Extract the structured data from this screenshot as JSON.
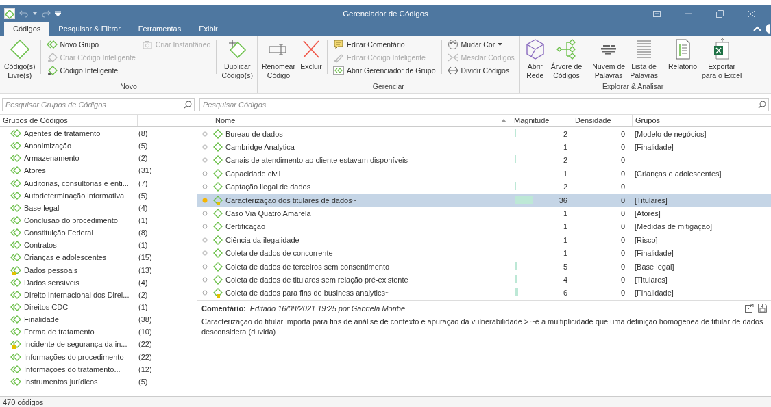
{
  "window": {
    "title": "Gerenciador de Códigos"
  },
  "tabs": [
    {
      "label": "Códigos",
      "selected": true
    },
    {
      "label": "Pesquisar & Filtrar",
      "selected": false
    },
    {
      "label": "Ferramentas",
      "selected": false
    },
    {
      "label": "Exibir",
      "selected": false
    }
  ],
  "ribbon": {
    "groups": [
      {
        "label": "Novo",
        "columns": [
          {
            "kind": "large",
            "label": "Código(s)\nLivre(s)",
            "disabled": false
          },
          {
            "kind": "separator"
          },
          {
            "kind": "stack",
            "items": [
              {
                "label": "Novo Grupo",
                "disabled": false,
                "has_menu": false
              },
              {
                "label": "Criar Código Inteligente",
                "disabled": true,
                "has_menu": false
              },
              {
                "label": "Código Inteligente",
                "disabled": false,
                "has_menu": false
              }
            ]
          },
          {
            "kind": "stack",
            "items": [
              {
                "label": "Criar Instantâneo",
                "disabled": true,
                "has_menu": false
              }
            ]
          },
          {
            "kind": "separator"
          },
          {
            "kind": "large",
            "label": "Duplicar\nCódigo(s)",
            "disabled": false
          }
        ]
      },
      {
        "label": "Gerenciar",
        "columns": [
          {
            "kind": "large",
            "label": "Renomear\nCódigo",
            "disabled": false
          },
          {
            "kind": "large",
            "label": "Excluir",
            "disabled": false
          },
          {
            "kind": "separator"
          },
          {
            "kind": "stack",
            "items": [
              {
                "label": "Editar Comentário",
                "disabled": false,
                "has_menu": false
              },
              {
                "label": "Editar Código Inteligente",
                "disabled": true,
                "has_menu": false
              },
              {
                "label": "Abrir Gerenciador de Grupo",
                "disabled": false,
                "has_menu": false
              }
            ]
          },
          {
            "kind": "separator"
          },
          {
            "kind": "stack",
            "items": [
              {
                "label": "Mudar Cor",
                "disabled": false,
                "has_menu": true
              },
              {
                "label": "Mesclar Códigos",
                "disabled": true,
                "has_menu": false
              },
              {
                "label": "Dividir Códigos",
                "disabled": false,
                "has_menu": false
              }
            ]
          }
        ]
      },
      {
        "label": "Explorar & Analisar",
        "columns": [
          {
            "kind": "large",
            "label": "Abrir\nRede",
            "disabled": false
          },
          {
            "kind": "large",
            "label": "Árvore de\nCódigos",
            "disabled": false
          },
          {
            "kind": "separator"
          },
          {
            "kind": "large",
            "label": "Nuvem de\nPalavras",
            "disabled": false
          },
          {
            "kind": "large",
            "label": "Lista de\nPalavras",
            "disabled": false
          },
          {
            "kind": "separator"
          },
          {
            "kind": "large",
            "label": "Relatório",
            "disabled": false
          },
          {
            "kind": "large",
            "label": "Exportar\npara o Excel",
            "disabled": false
          }
        ]
      }
    ]
  },
  "groups_panel": {
    "search": {
      "placeholder": "Pesquisar Grupos de Códigos"
    },
    "column": "Grupos de Códigos",
    "rows": [
      {
        "name": "Agentes de tratamento",
        "count": "(8)",
        "has_comment": false
      },
      {
        "name": "Anonimização",
        "count": "(5)",
        "has_comment": false
      },
      {
        "name": "Armazenamento",
        "count": "(2)",
        "has_comment": false
      },
      {
        "name": "Atores",
        "count": "(31)",
        "has_comment": false
      },
      {
        "name": "Auditorias, consultorias e enti...",
        "count": "(7)",
        "has_comment": false
      },
      {
        "name": "Autodeterminação informativa",
        "count": "(5)",
        "has_comment": false
      },
      {
        "name": "Base legal",
        "count": "(4)",
        "has_comment": false
      },
      {
        "name": "Conclusão do procedimento",
        "count": "(1)",
        "has_comment": false
      },
      {
        "name": "Constituição Federal",
        "count": "(8)",
        "has_comment": false
      },
      {
        "name": "Contratos",
        "count": "(1)",
        "has_comment": false
      },
      {
        "name": "Crianças e adolescentes",
        "count": "(15)",
        "has_comment": false
      },
      {
        "name": "Dados pessoais",
        "count": "(13)",
        "has_comment": true
      },
      {
        "name": "Dados sensíveis",
        "count": "(4)",
        "has_comment": false
      },
      {
        "name": "Direito Internacional dos Direi...",
        "count": "(2)",
        "has_comment": false
      },
      {
        "name": "Direitos CDC",
        "count": "(1)",
        "has_comment": false
      },
      {
        "name": "Finalidade",
        "count": "(38)",
        "has_comment": false
      },
      {
        "name": "Forma de tratamento",
        "count": "(10)",
        "has_comment": false
      },
      {
        "name": "Incidente de segurança da in...",
        "count": "(22)",
        "has_comment": true
      },
      {
        "name": "Informações do procedimento",
        "count": "(22)",
        "has_comment": false
      },
      {
        "name": "Informações do tratamento...",
        "count": "(12)",
        "has_comment": false
      },
      {
        "name": "Instrumentos jurídicos",
        "count": "(5)",
        "has_comment": false
      }
    ]
  },
  "codes_table": {
    "search": {
      "placeholder": "Pesquisar Códigos"
    },
    "columns": [
      "Nome",
      "Magnitude",
      "Densidade",
      "Grupos"
    ],
    "rows": [
      {
        "name": "Bureau de dados",
        "magnitude": "2",
        "density": "0",
        "groups": "[Modelo de negócios]",
        "selected": false,
        "has_comment": false
      },
      {
        "name": "Cambridge Analytica",
        "magnitude": "1",
        "density": "0",
        "groups": "[Finalidade]",
        "selected": false,
        "has_comment": false
      },
      {
        "name": "Canais de atendimento ao cliente estavam disponíveis",
        "magnitude": "2",
        "density": "0",
        "selected": false,
        "has_comment": false
      },
      {
        "name": "Capacidade civil",
        "magnitude": "1",
        "density": "0",
        "groups": "[Crianças e adolescentes]",
        "selected": false,
        "has_comment": false
      },
      {
        "name": "Captação ilegal de dados",
        "magnitude": "2",
        "density": "0",
        "selected": false,
        "has_comment": false
      },
      {
        "name": "Caracterização dos titulares de dados~",
        "magnitude": "36",
        "density": "0",
        "groups": "[Titulares]",
        "selected": true,
        "has_comment": true
      },
      {
        "name": "Caso Via Quatro Amarela",
        "magnitude": "1",
        "density": "0",
        "groups": "[Atores]",
        "selected": false,
        "has_comment": false
      },
      {
        "name": "Certificação",
        "magnitude": "1",
        "density": "0",
        "groups": "[Medidas de mitigação]",
        "selected": false,
        "has_comment": false
      },
      {
        "name": "Ciência da ilegalidade",
        "magnitude": "1",
        "density": "0",
        "groups": "[Risco]",
        "selected": false,
        "has_comment": false
      },
      {
        "name": "Coleta de dados de concorrente",
        "magnitude": "1",
        "density": "0",
        "groups": "[Finalidade]",
        "selected": false,
        "has_comment": false
      },
      {
        "name": "Coleta de dados de terceiros sem consentimento",
        "magnitude": "5",
        "density": "0",
        "groups": "[Base legal]",
        "selected": false,
        "has_comment": false
      },
      {
        "name": "Coleta de dados de titulares sem relação pré-existente",
        "magnitude": "4",
        "density": "0",
        "groups": "[Titulares]",
        "selected": false,
        "has_comment": false
      },
      {
        "name": "Coleta de dados para fins de business analytics~",
        "magnitude": "6",
        "density": "0",
        "groups": "[Finalidade]",
        "selected": false,
        "has_comment": true
      }
    ]
  },
  "comment": {
    "label": "Comentário:",
    "meta": "Editado 16/08/2021 19:25 por Gabriela Moribe",
    "text": "Caracterização do titular importa para fins de análise de contexto e apuração da vulnerabilidade > ~é a multiplicidade que uma definição homogenea de titular de dados desconsidera (duvida)"
  },
  "status_bar": {
    "text": "470 códigos"
  }
}
